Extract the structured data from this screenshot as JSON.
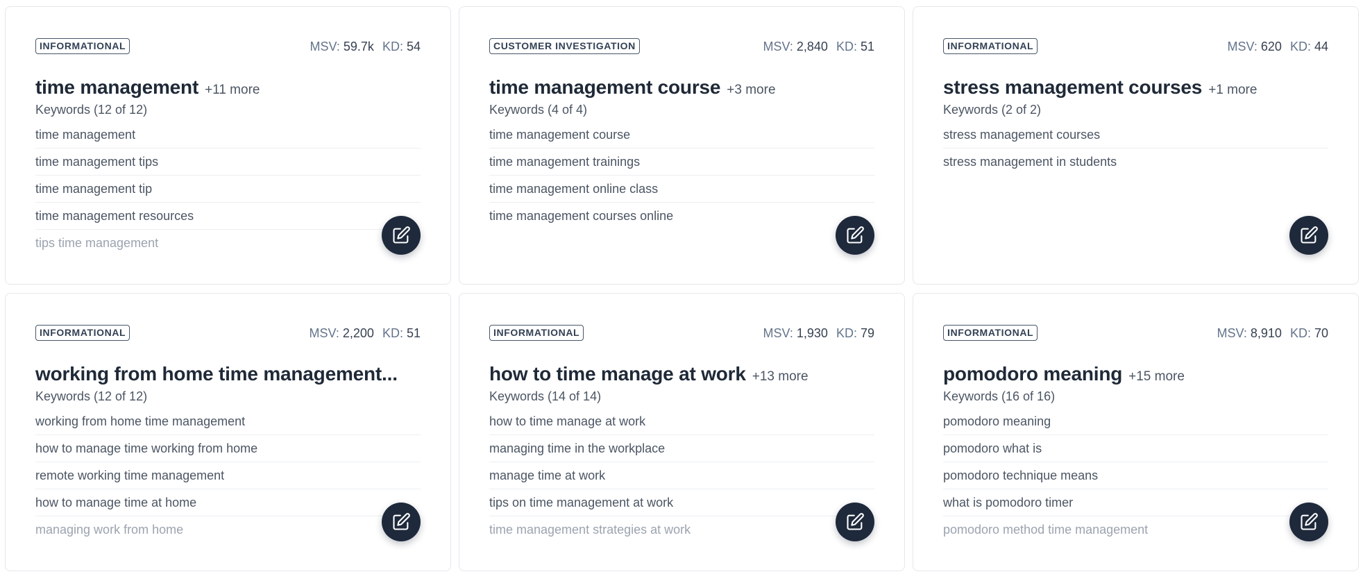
{
  "cards": [
    {
      "intent": "INFORMATIONAL",
      "msv_label": "MSV:",
      "msv_value": "59.7k",
      "kd_label": "KD:",
      "kd_value": "54",
      "title": "time management",
      "more": "+11 more",
      "keywords_summary": "Keywords (12 of 12)",
      "keywords": [
        "time management",
        "time management tips",
        "time management tip",
        "time management resources",
        "tips time management"
      ],
      "edit_icon": "pencil-square-icon"
    },
    {
      "intent": "CUSTOMER INVESTIGATION",
      "msv_label": "MSV:",
      "msv_value": "2,840",
      "kd_label": "KD:",
      "kd_value": "51",
      "title": "time management course",
      "more": "+3 more",
      "keywords_summary": "Keywords (4 of 4)",
      "keywords": [
        "time management course",
        "time management trainings",
        "time management online class",
        "time management courses online"
      ],
      "edit_icon": "pencil-square-icon"
    },
    {
      "intent": "INFORMATIONAL",
      "msv_label": "MSV:",
      "msv_value": "620",
      "kd_label": "KD:",
      "kd_value": "44",
      "title": "stress management courses",
      "more": "+1 more",
      "keywords_summary": "Keywords (2 of 2)",
      "keywords": [
        "stress management courses",
        "stress management in students"
      ],
      "edit_icon": "pencil-square-icon"
    },
    {
      "intent": "INFORMATIONAL",
      "msv_label": "MSV:",
      "msv_value": "2,200",
      "kd_label": "KD:",
      "kd_value": "51",
      "title": "working from home time management...",
      "more": "",
      "keywords_summary": "Keywords (12 of 12)",
      "keywords": [
        "working from home time management",
        "how to manage time working from home",
        "remote working time management",
        "how to manage time at home",
        "managing work from home"
      ],
      "edit_icon": "pencil-square-icon"
    },
    {
      "intent": "INFORMATIONAL",
      "msv_label": "MSV:",
      "msv_value": "1,930",
      "kd_label": "KD:",
      "kd_value": "79",
      "title": "how to time manage at work",
      "more": "+13 more",
      "keywords_summary": "Keywords (14 of 14)",
      "keywords": [
        "how to time manage at work",
        "managing time in the workplace",
        "manage time at work",
        "tips on time management at work",
        "time management strategies at work"
      ],
      "edit_icon": "pencil-square-icon"
    },
    {
      "intent": "INFORMATIONAL",
      "msv_label": "MSV:",
      "msv_value": "8,910",
      "kd_label": "KD:",
      "kd_value": "70",
      "title": "pomodoro meaning",
      "more": "+15 more",
      "keywords_summary": "Keywords (16 of 16)",
      "keywords": [
        "pomodoro meaning",
        "pomodoro what is",
        "pomodoro technique means",
        "what is pomodoro timer",
        "pomodoro method time management"
      ],
      "edit_icon": "pencil-square-icon"
    }
  ]
}
